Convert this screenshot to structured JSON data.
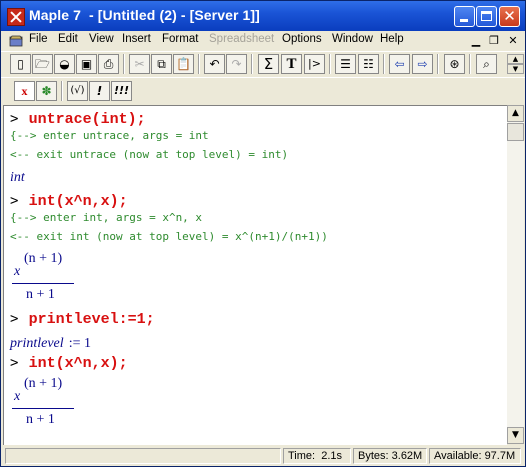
{
  "window": {
    "title": "Maple 7  - [Untitled (2) - [Server 1]]"
  },
  "menu": [
    "File",
    "Edit",
    "View",
    "Insert",
    "Format",
    "Spreadsheet",
    "Options",
    "Window",
    "Help"
  ],
  "toolbar1": {
    "sigma": "Σ",
    "t": "T",
    "exec": "|>"
  },
  "toolbar2": {
    "x": "x",
    "check": "(√)",
    "bang": "!",
    "bangs": "!!!"
  },
  "worksheet": {
    "prompt": ">",
    "cmd1": "untrace(int);",
    "trace1": "{--> enter untrace, args = int",
    "trace2": "<-- exit untrace (now at top level) = int)",
    "out1": "int",
    "cmd2": "int(x^n,x);",
    "trace3": "{--> enter int, args = x^n, x",
    "trace4": "<-- exit int (now at top level) = x^(n+1)/(n+1))",
    "frac_x": "x",
    "frac_exp": "(n + 1)",
    "frac_den": "n + 1",
    "cmd3": "printlevel:=1;",
    "out2_lhs": "printlevel",
    "out2_rhs": ":= 1",
    "cmd4": "int(x^n,x);"
  },
  "status": {
    "time_label": "Time:",
    "time": "2.1s",
    "bytes_label": "Bytes:",
    "bytes": "3.62M",
    "avail_label": "Available:",
    "avail": "97.7M"
  }
}
